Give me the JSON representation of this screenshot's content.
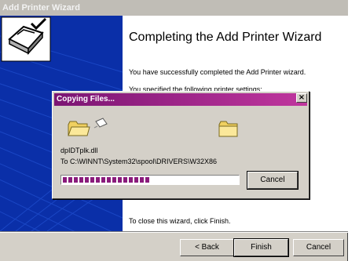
{
  "wizard": {
    "window_title": "Add Printer Wizard",
    "heading": "Completing the Add Printer Wizard",
    "success_text": "You have successfully completed the Add Printer wizard.",
    "settings_text": "You specified the following printer settings:",
    "close_text": "To close this wizard, click Finish.",
    "buttons": {
      "back": "< Back",
      "finish": "Finish",
      "cancel": "Cancel"
    },
    "icon": "printer-check-icon"
  },
  "copy_dialog": {
    "title": "Copying Files...",
    "close_glyph": "×",
    "file_name": "dpIDTplk.dll",
    "destination": "To C:\\WINNT\\System32\\spool\\DRIVERS\\W32X86",
    "cancel_label": "Cancel",
    "progress": 0.5,
    "icons": {
      "source": "folder-icon",
      "flying": "flying-document-icon",
      "destination": "folder-icon"
    }
  },
  "colors": {
    "wizard_banner": "#0a2fa8",
    "dialog_title": "#7b1573",
    "progress_fill": "#8a1b7c",
    "folder": "#f0d060"
  }
}
